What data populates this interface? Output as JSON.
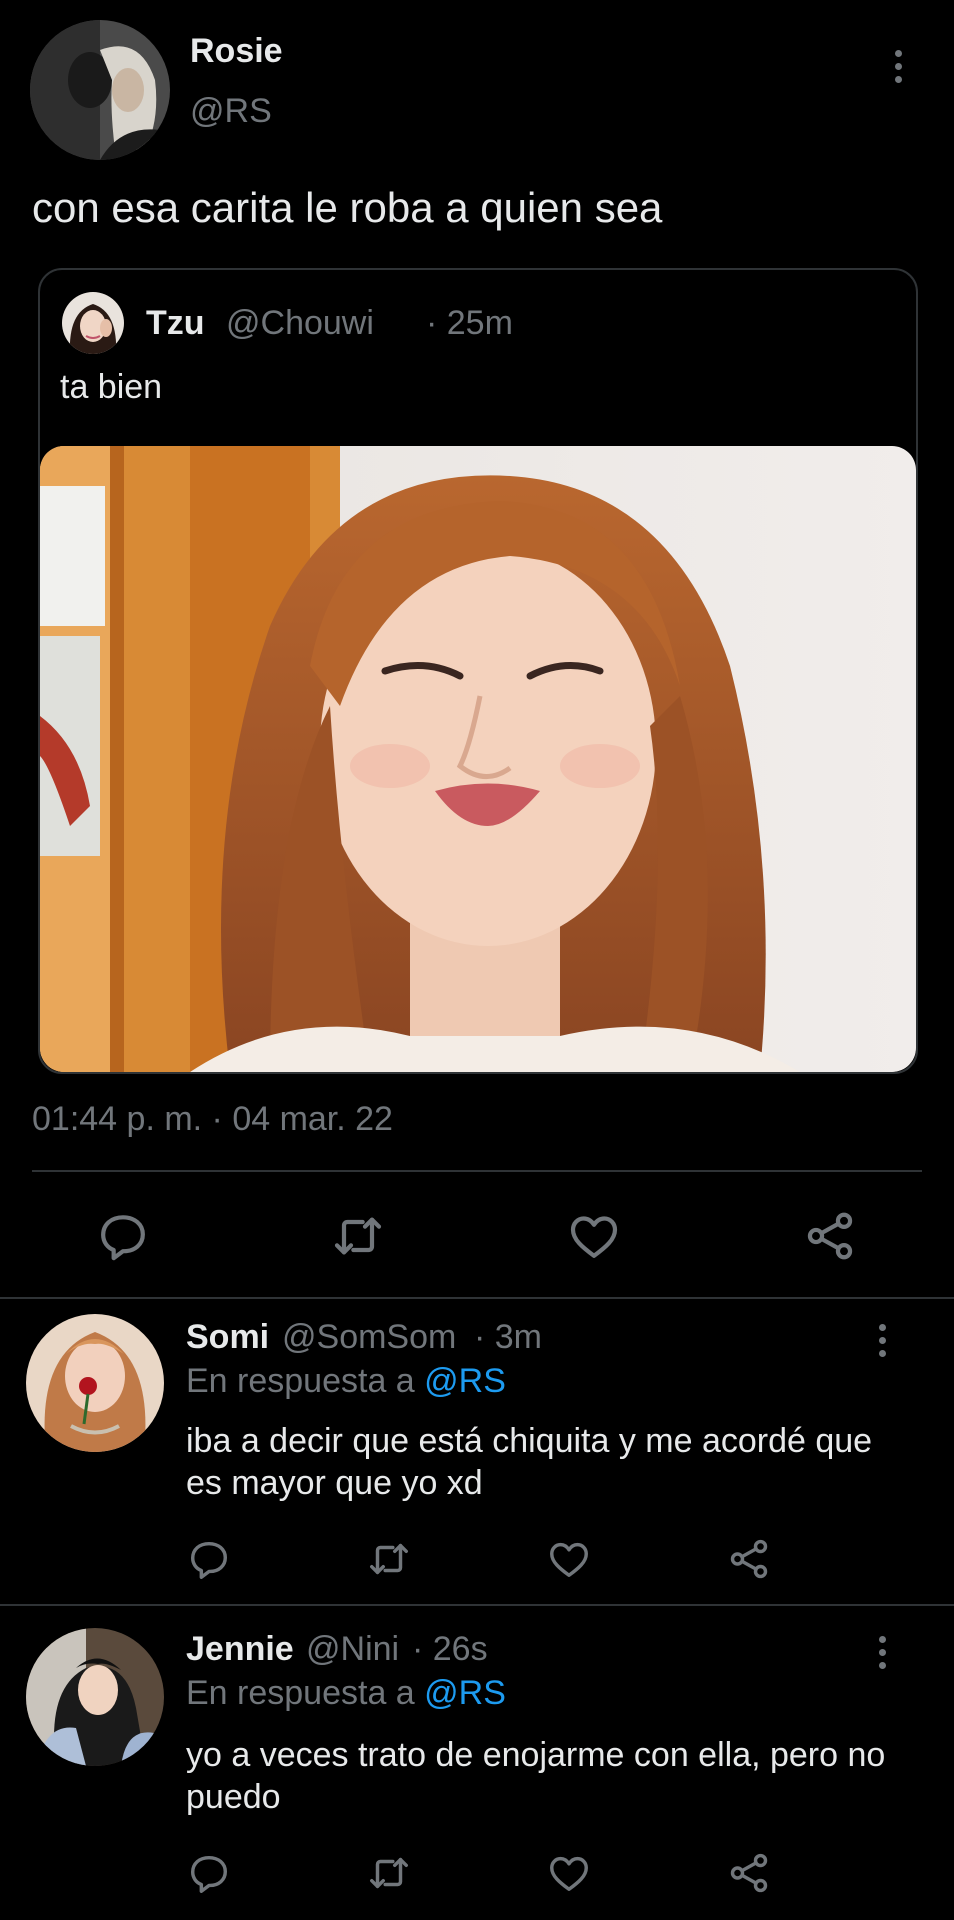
{
  "main_tweet": {
    "author_name": "Rosie",
    "author_handle": "@RS",
    "text": "con esa carita le roba a quien sea",
    "timestamp": "01:44 p. m. · 04 mar. 22"
  },
  "quoted_tweet": {
    "author_name": "Tzu",
    "author_handle": "@Chouwi",
    "time": "· 25m",
    "text": "ta bien"
  },
  "replies": [
    {
      "author_name": "Somi",
      "author_handle": "@SomSom",
      "time": "· 3m",
      "reply_prefix": "En respuesta a",
      "reply_to": "@RS",
      "text": "iba a decir que está chiquita y me acordé que es mayor que yo xd"
    },
    {
      "author_name": "Jennie",
      "author_handle": "@Nini",
      "time": "· 26s",
      "reply_prefix": "En respuesta a",
      "reply_to": "@RS",
      "text": "yo a veces trato de enojarme con ella, pero no puedo"
    }
  ],
  "icons": [
    "more-vertical-icon",
    "reply-icon",
    "retweet-icon",
    "like-icon",
    "share-icon"
  ],
  "colors": {
    "background": "#000000",
    "text": "#e7e9ea",
    "muted": "#71767b",
    "link": "#1d9bf0",
    "border": "#2f3336"
  }
}
